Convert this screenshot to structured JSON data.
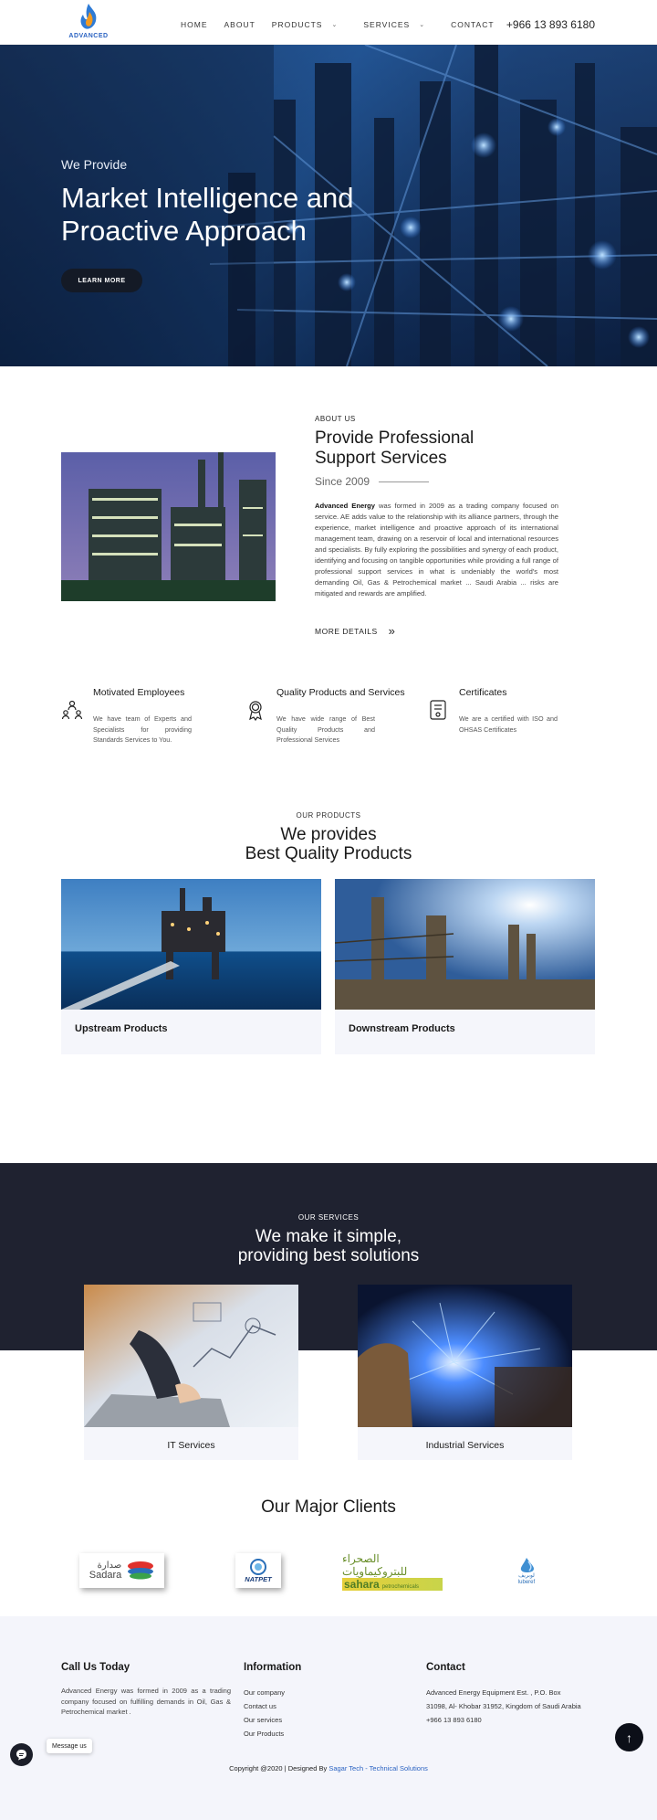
{
  "header": {
    "logo_text": "ADVANCED",
    "nav": [
      {
        "label": "HOME"
      },
      {
        "label": "ABOUT"
      },
      {
        "label": "PRODUCTS",
        "has_dropdown": true
      },
      {
        "label": "SERVICES",
        "has_dropdown": true
      },
      {
        "label": "CONTACT"
      }
    ],
    "phone": "+966 13 893 6180"
  },
  "hero": {
    "subtitle": "We Provide",
    "title": "Market Intelligence and Proactive Approach",
    "button": "LEARN MORE"
  },
  "about": {
    "eyebrow": "ABOUT US",
    "title": "Provide Professional Support Services",
    "since": "Since 2009",
    "company": "Advanced Energy",
    "text": " was formed in 2009 as a trading company focused on service. AE adds value to the relationship with its alliance partners, through the experience, market intelligence and proactive approach of its international management team, drawing on a reservoir of local and international resources and specialists. By fully exploring the possibilities and synergy of each product, identifying and focusing on tangible opportunities while providing a full range of professional support services in what is undeniably the world's most demanding Oil, Gas & Petrochemical market ... Saudi Arabia ... risks are mitigated and rewards are amplified.",
    "more": "MORE DETAILS"
  },
  "features": [
    {
      "title": "Motivated Employees",
      "text": "We have team of Experts and Specialists for providing Standards Services to You.",
      "icon": "team-icon"
    },
    {
      "title": "Quality Products and Services",
      "text": "We have wide range of Best Quality Products and Professional Services",
      "icon": "award-icon"
    },
    {
      "title": "Certificates",
      "text": "We are a certified with ISO and OHSAS Certificates",
      "icon": "certificate-icon"
    }
  ],
  "products": {
    "eyebrow": "OUR PRODUCTS",
    "title_line1": "We provides",
    "title_line2": "Best Quality Products",
    "items": [
      {
        "label": "Upstream Products"
      },
      {
        "label": "Downstream Products"
      }
    ]
  },
  "services": {
    "eyebrow": "OUR SERVICES",
    "title_line1": "We make it simple,",
    "title_line2": "providing best solutions",
    "items": [
      {
        "label": "IT Services"
      },
      {
        "label": "Industrial Services"
      }
    ]
  },
  "clients": {
    "title": "Our Major Clients",
    "logos": [
      {
        "name": "Sadara",
        "arabic": "صدارة"
      },
      {
        "name": "NATPET"
      },
      {
        "name": "sahara",
        "arabic": "الصحراء للبتروكيماويات",
        "sub": "petrochemicals"
      },
      {
        "name": "luberef",
        "arabic": "لوبريف"
      }
    ]
  },
  "footer": {
    "call": {
      "title": "Call Us Today",
      "text": "Advanced Energy was formed in 2009 as a trading company focused on fulfilling demands in Oil, Gas & Petrochemical market ."
    },
    "info": {
      "title": "Information",
      "links": [
        "Our company",
        "Contact us",
        "Our services",
        "Our Products"
      ]
    },
    "contact": {
      "title": "Contact",
      "address": "Advanced Energy Equipment Est. , P.O. Box 31098, Al- Khobar 31952, Kingdom of Saudi Arabia",
      "phone": "+966 13 893 6180"
    },
    "copyright": "Copyright @2020 | Designed By ",
    "designer": "Sagar Tech - Technical Solutions"
  },
  "widgets": {
    "message_label": "Message us"
  },
  "colors": {
    "dark": "#1f2230",
    "accent": "#2b63c2",
    "card_bg": "#f5f6fb"
  }
}
